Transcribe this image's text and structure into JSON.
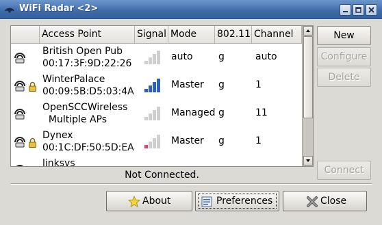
{
  "window": {
    "title": "WiFi Radar <2>",
    "icon": "radar-icon",
    "controls": [
      "minimize-icon",
      "maximize-icon",
      "close-icon"
    ]
  },
  "table": {
    "headers": [
      "",
      "Access Point",
      "Signal",
      "Mode",
      "802.11",
      "Channel"
    ],
    "rows": [
      {
        "name": "British Open Pub",
        "sub": "00:17:3F:9D:22:26",
        "locked": false,
        "signal_bars": 0,
        "signal_color": "#cfcfcf",
        "mode": "auto",
        "protocol": "g",
        "channel": "auto"
      },
      {
        "name": "WinterPalace",
        "sub": "00:09:5B:D5:03:4A",
        "locked": true,
        "signal_bars": 4,
        "signal_color": "#2f5fbf",
        "mode": "Master",
        "protocol": "g",
        "channel": "1"
      },
      {
        "name": "OpenSCCWireless",
        "sub": "  Multiple APs",
        "locked": false,
        "signal_bars": 0,
        "signal_color": "#cfcfcf",
        "mode": "Managed",
        "protocol": "g",
        "channel": "11"
      },
      {
        "name": "Dynex",
        "sub": "00:1C:DF:50:5D:EA",
        "locked": true,
        "signal_bars": 1,
        "signal_color": "#d6456b",
        "mode": "Master",
        "protocol": "g",
        "channel": "1"
      },
      {
        "name": "linksys",
        "sub": "",
        "locked": false,
        "signal_bars": 0,
        "signal_color": "#cfcfcf",
        "mode": "",
        "protocol": "",
        "channel": ""
      }
    ]
  },
  "side_buttons": {
    "new": "New",
    "configure": "Configure",
    "delete": "Delete",
    "connect": "Connect"
  },
  "status_text": "Not Connected.",
  "bottom_buttons": {
    "about": "About",
    "preferences": "Preferences",
    "close": "Close"
  },
  "colors": {
    "title_bar": "#3f6aa8",
    "signal_strong": "#2f5fbf",
    "signal_weak": "#d6456b",
    "signal_none": "#cfcfcf"
  }
}
